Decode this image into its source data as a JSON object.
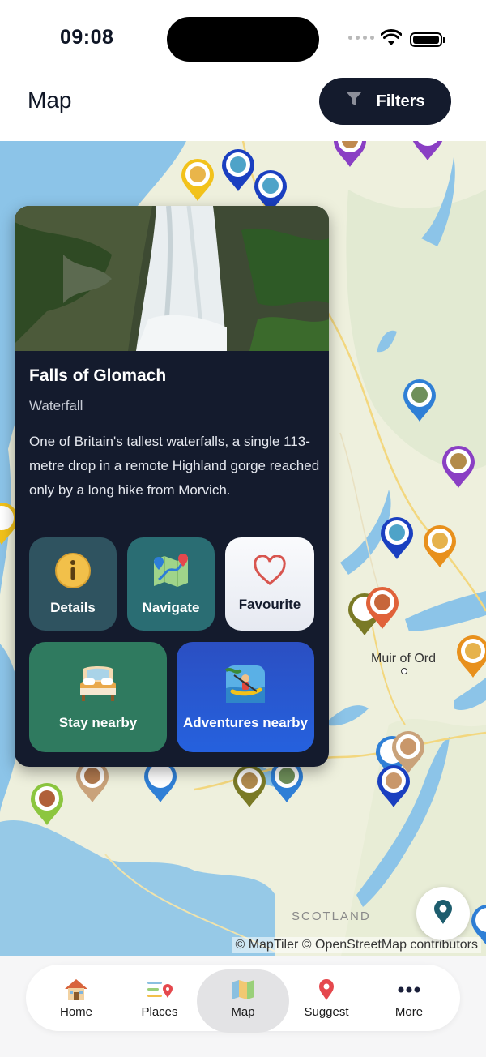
{
  "status": {
    "time": "09:08"
  },
  "header": {
    "title": "Map",
    "filters_label": "Filters"
  },
  "map": {
    "town": "Muir of Ord",
    "region": "SCOTLAND",
    "attribution": "© MapTiler © OpenStreetMap contributors"
  },
  "place": {
    "name": "Falls of Glomach",
    "category": "Waterfall",
    "description": "One of Britain's tallest waterfalls, a single 113-metre drop in a remote Highland gorge reached only by a long hike from Morvich.",
    "actions": {
      "details": "Details",
      "navigate": "Navigate",
      "favourite": "Favourite",
      "stay": "Stay nearby",
      "adventures": "Adventures nearby"
    }
  },
  "tabs": [
    {
      "label": "Home",
      "icon": "home-icon"
    },
    {
      "label": "Places",
      "icon": "places-icon"
    },
    {
      "label": "Map",
      "icon": "map-icon",
      "active": true
    },
    {
      "label": "Suggest",
      "icon": "suggest-pin-icon"
    },
    {
      "label": "More",
      "icon": "more-dots-icon"
    }
  ],
  "colors": {
    "navy": "#141b2d",
    "pin_blue": "#2f7fd6",
    "pin_purple": "#8a3fc4",
    "pin_orange": "#e8901c",
    "pin_olive": "#7a7a26",
    "pin_darkblue": "#1a3fc0",
    "pin_tan": "#c9a27a",
    "pin_lime": "#8cc63f",
    "pin_yellow": "#f2c21b",
    "water": "#8cc4e8"
  }
}
